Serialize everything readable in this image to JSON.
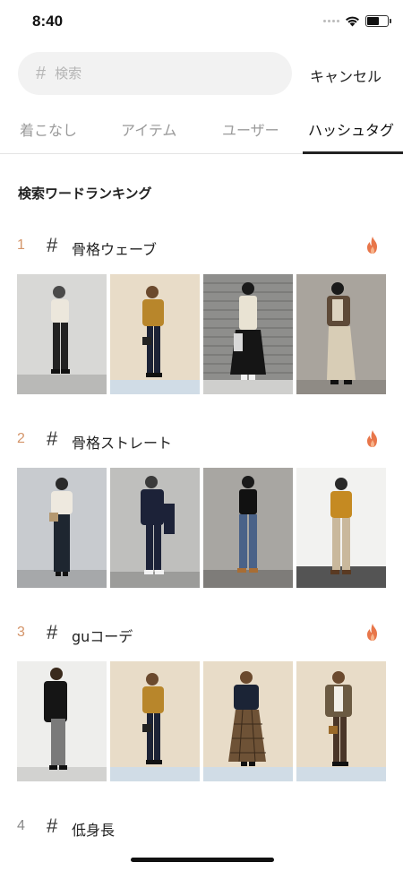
{
  "status": {
    "time": "8:40"
  },
  "search": {
    "placeholder": "検索",
    "hash": "#",
    "cancel_label": "キャンセル"
  },
  "tabs": [
    {
      "label": "着こなし",
      "active": false
    },
    {
      "label": "アイテム",
      "active": false
    },
    {
      "label": "ユーザー",
      "active": false
    },
    {
      "label": "ハッシュタグ",
      "active": true
    }
  ],
  "section_title": "検索ワードランキング",
  "rankings": [
    {
      "rank": "1",
      "hash": "#",
      "tag": "骨格ウェーブ",
      "icon": "fire-icon"
    },
    {
      "rank": "2",
      "hash": "#",
      "tag": "骨格ストレート",
      "icon": "fire-icon"
    },
    {
      "rank": "3",
      "hash": "#",
      "tag": "guコーデ",
      "icon": "fire-icon"
    },
    {
      "rank": "4",
      "hash": "#",
      "tag": "低身長",
      "icon": ""
    }
  ],
  "colors": {
    "accent_rank": "#d4956a",
    "fire": "#e8764a",
    "active_tab": "#111111",
    "inactive_tab": "#9a9a9a"
  }
}
